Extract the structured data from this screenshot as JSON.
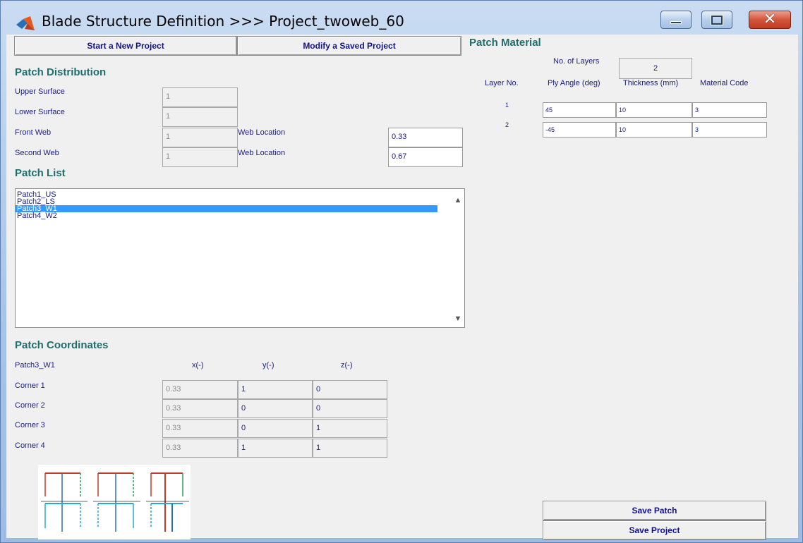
{
  "window": {
    "title": "Blade Structure Definition >>> Project_twoweb_60",
    "icons": {
      "app": "matlab-logo-icon",
      "minimize": "minimize-icon",
      "maximize": "maximize-icon",
      "close": "close-icon"
    },
    "colors": {
      "heading": "#1f6e6e",
      "label": "#1d2080",
      "selection": "#3399ff"
    }
  },
  "toolbar": {
    "new_project": "Start a New Project",
    "modify_project": "Modify a Saved Project"
  },
  "patch_distribution": {
    "heading": "Patch Distribution",
    "upper_surface": {
      "label": "Upper Surface",
      "value": "1"
    },
    "lower_surface": {
      "label": "Lower Surface",
      "value": "1"
    },
    "front_web": {
      "label": "Front Web",
      "value": "1",
      "location_label": "Web Location",
      "location_value": "0.33"
    },
    "second_web": {
      "label": "Second Web",
      "value": "1",
      "location_label": "Web Location",
      "location_value": "0.67"
    }
  },
  "patch_list": {
    "heading": "Patch List",
    "items": [
      "Patch1_US",
      "Patch2_LS",
      "Patch3_W1",
      "Patch4_W2"
    ],
    "selected": "Patch3_W1"
  },
  "patch_coordinates": {
    "heading": "Patch Coordinates",
    "patch_name": "Patch3_W1",
    "columns": [
      "x(-)",
      "y(-)",
      "z(-)"
    ],
    "corners": [
      {
        "label": "Corner 1",
        "x": "0.33",
        "y": "1",
        "z": "0"
      },
      {
        "label": "Corner 2",
        "x": "0.33",
        "y": "0",
        "z": "0"
      },
      {
        "label": "Corner 3",
        "x": "0.33",
        "y": "0",
        "z": "1"
      },
      {
        "label": "Corner 4",
        "x": "0.33",
        "y": "1",
        "z": "1"
      }
    ]
  },
  "patch_material": {
    "heading": "Patch Material",
    "no_layers_label": "No. of Layers",
    "no_layers_value": "2",
    "columns": [
      "Layer No.",
      "Ply Angle (deg)",
      "Thickness (mm)",
      "Material Code"
    ],
    "layers": [
      {
        "no": "1",
        "angle": "45",
        "thickness": "10",
        "code": "3"
      },
      {
        "no": "2",
        "angle": "-45",
        "thickness": "10",
        "code": "3"
      }
    ]
  },
  "actions": {
    "save_patch": "Save Patch",
    "save_project": "Save Project"
  }
}
